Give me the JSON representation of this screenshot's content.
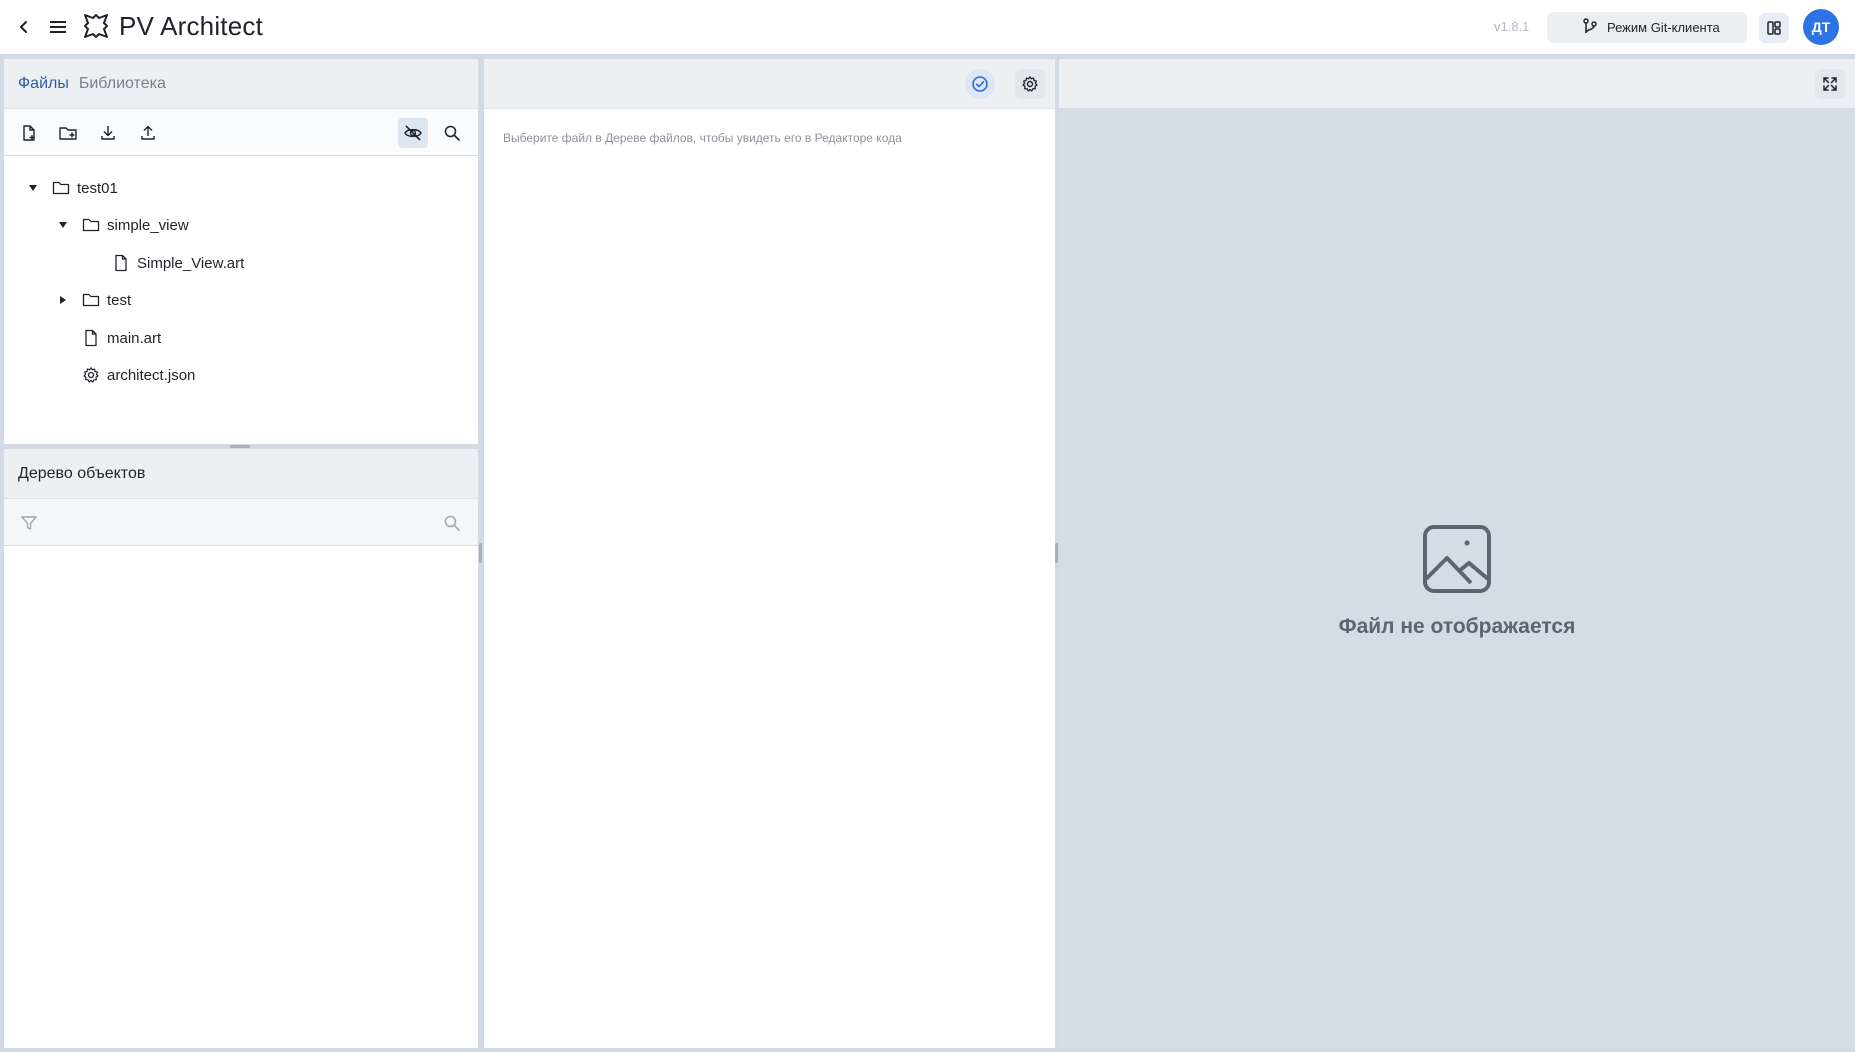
{
  "app": {
    "title": "PV Architect",
    "version": "v1.8.1",
    "git_mode_label": "Режим Git-клиента",
    "avatar_initials": "ДТ",
    "accent_color": "#2e73e6"
  },
  "files_panel": {
    "tabs": [
      {
        "label": "Файлы",
        "active": true
      },
      {
        "label": "Библиотека",
        "active": false
      }
    ],
    "toolbar": [
      "new-file-icon",
      "new-folder-icon",
      "download-icon",
      "upload-icon",
      "hide-eye-icon",
      "search-icon"
    ],
    "tree": [
      {
        "label": "test01",
        "type": "folder",
        "expanded": true
      },
      {
        "label": "simple_view",
        "type": "folder",
        "expanded": true
      },
      {
        "label": "Simple_View.art",
        "type": "file"
      },
      {
        "label": "test",
        "type": "folder",
        "expanded": false
      },
      {
        "label": "main.art",
        "type": "file"
      },
      {
        "label": "architect.json",
        "type": "config"
      }
    ]
  },
  "objects_panel": {
    "title": "Дерево объектов"
  },
  "editor": {
    "hint": "Выберите файл в Дереве файлов, чтобы увидеть его в Редакторе кода"
  },
  "preview": {
    "empty_text": "Файл не отображается"
  }
}
